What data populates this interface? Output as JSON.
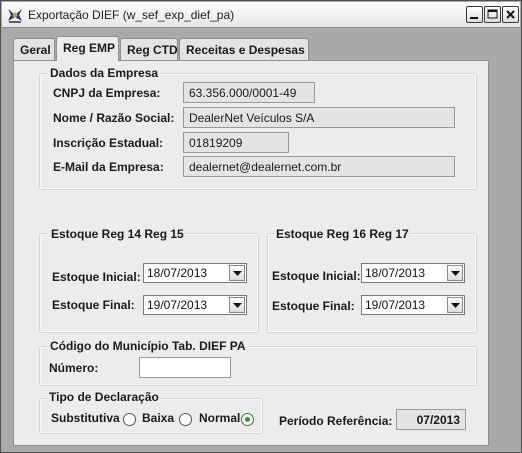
{
  "window": {
    "title": "Exportação DIEF (w_sef_exp_dief_pa)"
  },
  "tabs": [
    {
      "label": "Geral"
    },
    {
      "label": "Reg EMP"
    },
    {
      "label": "Reg CTD"
    },
    {
      "label": "Receitas e Despesas"
    }
  ],
  "empresa": {
    "group_title": "Dados da Empresa",
    "cnpj_label": "CNPJ da Empresa:",
    "cnpj_value": "63.356.000/0001-49",
    "nome_label": "Nome / Razão Social:",
    "nome_value": "DealerNet Veículos S/A",
    "ie_label": "Inscrição Estadual:",
    "ie_value": "01819209",
    "email_label": "E-Mail da Empresa:",
    "email_value": "dealernet@dealernet.com.br"
  },
  "estoque_14_15": {
    "group_title": "Estoque Reg 14  Reg 15",
    "inicial_label": "Estoque Inicial:",
    "inicial_value": "18/07/2013",
    "final_label": "Estoque Final:",
    "final_value": "19/07/2013"
  },
  "estoque_16_17": {
    "group_title": "Estoque Reg 16 Reg 17",
    "inicial_label": "Estoque Inicial:",
    "inicial_value": "18/07/2013",
    "final_label": "Estoque Final:",
    "final_value": "19/07/2013"
  },
  "municipio": {
    "group_title": "Código do Município Tab. DIEF PA",
    "numero_label": "Número:",
    "numero_value": ""
  },
  "declaracao": {
    "group_title": "Tipo de Declaração",
    "options": [
      {
        "label": "Substitutiva",
        "checked": false
      },
      {
        "label": "Baixa",
        "checked": false
      },
      {
        "label": "Normal",
        "checked": true
      }
    ]
  },
  "periodo": {
    "label": "Período Referência:",
    "value": "07/2013"
  },
  "icons": {
    "app": "app-icon",
    "minimize": "minimize-icon",
    "maximize": "maximize-icon",
    "close": "close-icon",
    "dropdown": "chevron-down-icon"
  }
}
